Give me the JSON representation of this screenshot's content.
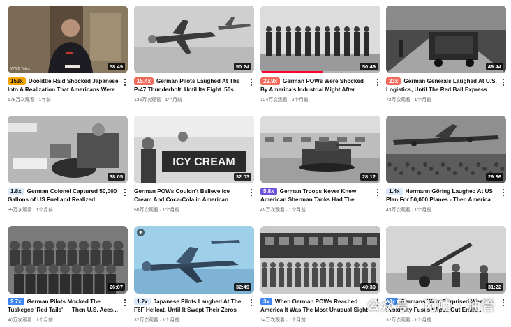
{
  "videos": [
    {
      "multiplier": "153x",
      "mult_bg": "#f7a600",
      "mult_fg": "#0f0f0f",
      "title": "Doolittle Raid Shocked Japanese Into A Realization That Americans Were Onl...",
      "views": "175万次观看",
      "age": "1年前",
      "duration": "58:49",
      "channel_watermark": "WW2 Tales",
      "thumb": "interview"
    },
    {
      "multiplier": "15.4x",
      "mult_bg": "#f26a5a",
      "mult_fg": "#ffffff",
      "title": "German Pilots Laughed At The P-47 Thunderbolt, Until Its Eight .50s Rained...",
      "views": "136万次观看",
      "age": "1个月前",
      "duration": "50:24",
      "thumb": "fighters"
    },
    {
      "multiplier": "29.9x",
      "mult_bg": "#f26a5a",
      "mult_fg": "#ffffff",
      "title": "German POWs Were Shocked By America's Industrial Might After Arriving In...",
      "views": "124万次观看",
      "age": "2个月前",
      "duration": "50:49",
      "progress": 0.52,
      "thumb": "marching"
    },
    {
      "multiplier": "23x",
      "mult_bg": "#f26a5a",
      "mult_fg": "#ffffff",
      "title": "German Generals Laughed At U.S. Logistics, Until The Red Ball Express Fueled...",
      "views": "72万次观看",
      "age": "1个月前",
      "duration": "49:44",
      "thumb": "trucks"
    },
    {
      "multiplier": "1.8x",
      "mult_bg": "#dbe9fb",
      "mult_fg": "#0f0f0f",
      "title": "German Colonel Captured 50,000 Gallons of US Fuel and Realized Germany...",
      "views": "55万次观看",
      "age": "1个月前",
      "duration": "38:05",
      "thumb": "fuel"
    },
    {
      "multiplier": "",
      "mult_bg": "",
      "mult_fg": "",
      "title": "German POWs Couldn't Believe Ice Cream And Coca-Cola in American Prison Camps...",
      "views": "50万次观看",
      "age": "1个月前",
      "duration": "32:03",
      "sign_text": "ICY CREAM",
      "thumb": "icecream"
    },
    {
      "multiplier": "5.8x",
      "mult_bg": "#6f52d9",
      "mult_fg": "#ffffff",
      "title": "German Troops Never Knew American Sherman Tanks Had The World's...",
      "views": "49万次观看",
      "age": "1个月前",
      "duration": "28:12",
      "thumb": "tanks"
    },
    {
      "multiplier": "1.4x",
      "mult_bg": "#dbe9fb",
      "mult_fg": "#0f0f0f",
      "title": "Hermann Göring Laughed At US Plan For 50,000 Planes - Then America Built...",
      "views": "43万次观看",
      "age": "1个月前",
      "duration": "29:36",
      "thumb": "bomber"
    },
    {
      "multiplier": "2.7x",
      "mult_bg": "#3f86f0",
      "mult_fg": "#ffffff",
      "title": "German Pilots Mocked The Tuskegee 'Red Tails' — Then U.S. Aces...",
      "views": "40万次观看",
      "age": "1个月前",
      "duration": "26:07",
      "thumb": "pilots"
    },
    {
      "multiplier": "1.2x",
      "mult_bg": "#dbe9fb",
      "mult_fg": "#0f0f0f",
      "title": "Japanese Pilots Laughed At The F6F Hellcat, Until It Swept Their Zeros From The...",
      "views": "37万次观看",
      "age": "1个月前",
      "duration": "32:49",
      "thumb": "hellcat",
      "badge": "✦"
    },
    {
      "multiplier": "3x",
      "mult_bg": "#3f86f0",
      "mult_fg": "#ffffff",
      "title": "When German POWs Reached America It Was The Most Unusual Sight For...",
      "views": "34万次观看",
      "age": "1个月前",
      "duration": "40:39",
      "thumb": "train"
    },
    {
      "multiplier": "3x",
      "mult_bg": "#3f86f0",
      "mult_fg": "#ffffff",
      "title": "Germans Were Surprised When Proximity Fuses Wiped Out Entire...",
      "views": "32万次观看",
      "age": "1个月前",
      "duration": "31:22",
      "thumb": "aagun"
    }
  ],
  "watermark": "公众号 · 阿嚏 · 油管",
  "separator": " · "
}
